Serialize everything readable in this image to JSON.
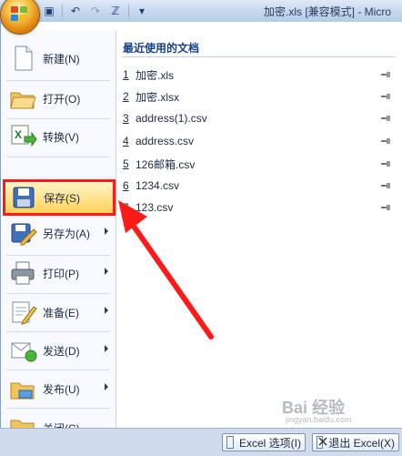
{
  "window": {
    "title": "加密.xls  [兼容模式] - Micro"
  },
  "quick_access": [
    "save-icon",
    "undo-icon",
    "redo-icon",
    "spell-icon",
    "dropdown-icon"
  ],
  "menu": {
    "commands": [
      {
        "id": "new",
        "label": "新建(N)",
        "icon": "new-document-icon",
        "submenu": false
      },
      {
        "id": "open",
        "label": "打开(O)",
        "icon": "open-folder-icon",
        "submenu": false
      },
      {
        "id": "convert",
        "label": "转换(V)",
        "icon": "convert-icon",
        "submenu": false
      },
      {
        "id": "save",
        "label": "保存(S)",
        "icon": "save-disk-icon",
        "submenu": false,
        "highlighted": true
      },
      {
        "id": "saveas",
        "label": "另存为(A)",
        "icon": "save-as-icon",
        "submenu": true
      },
      {
        "id": "print",
        "label": "打印(P)",
        "icon": "printer-icon",
        "submenu": true
      },
      {
        "id": "prepare",
        "label": "准备(E)",
        "icon": "prepare-icon",
        "submenu": true
      },
      {
        "id": "send",
        "label": "发送(D)",
        "icon": "send-icon",
        "submenu": true
      },
      {
        "id": "publish",
        "label": "发布(U)",
        "icon": "publish-icon",
        "submenu": true
      },
      {
        "id": "close",
        "label": "关闭(C)",
        "icon": "close-folder-icon",
        "submenu": false
      }
    ]
  },
  "recent": {
    "title": "最近使用的文档",
    "files": [
      {
        "num": "1",
        "name": "加密.xls"
      },
      {
        "num": "2",
        "name": "加密.xlsx"
      },
      {
        "num": "3",
        "name": "address(1).csv"
      },
      {
        "num": "4",
        "name": "address.csv"
      },
      {
        "num": "5",
        "name": "126邮箱.csv"
      },
      {
        "num": "6",
        "name": "1234.csv"
      },
      {
        "num": "7",
        "name": "123.csv"
      }
    ]
  },
  "footer": {
    "options_label": "Excel 选项(I)",
    "exit_label": "退出 Excel(X)"
  },
  "annotation": {
    "arrow_color": "#ff1a1a"
  },
  "watermark": {
    "text": "Bai 经验",
    "sub": "jingyan.baidu.com"
  }
}
